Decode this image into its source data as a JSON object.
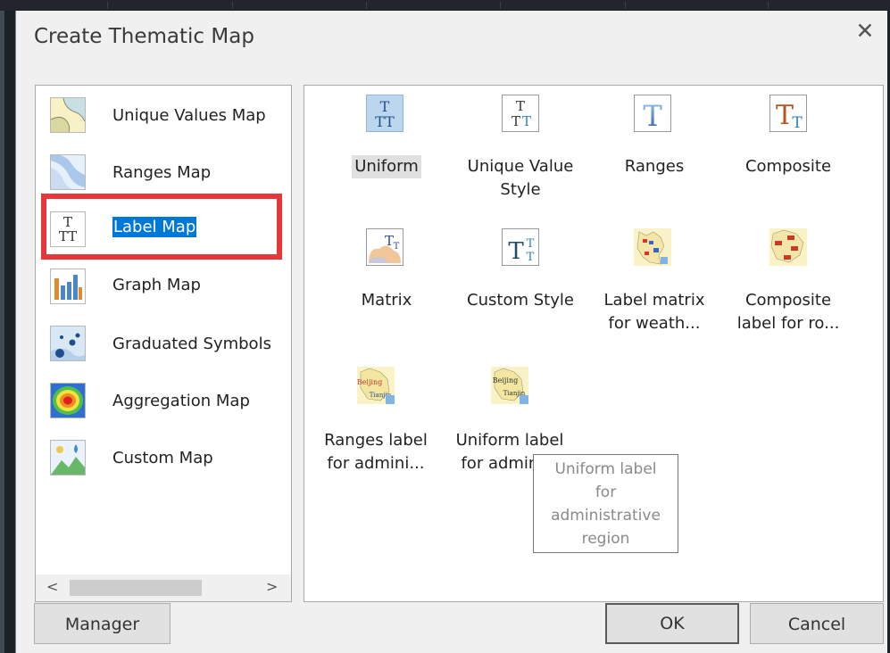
{
  "dialog": {
    "title": "Create Thematic Map",
    "close_symbol": "✕"
  },
  "left_list": {
    "items": [
      {
        "label": "Unique Values Map",
        "icon": "unique-values-map-icon"
      },
      {
        "label": "Ranges Map",
        "icon": "ranges-map-icon"
      },
      {
        "label": "Label Map",
        "icon": "label-map-icon",
        "selected": true
      },
      {
        "label": "Graph Map",
        "icon": "graph-map-icon"
      },
      {
        "label": "Graduated Symbols",
        "icon": "graduated-symbols-icon"
      },
      {
        "label": "Aggregation Map",
        "icon": "aggregation-map-icon"
      },
      {
        "label": "Custom Map",
        "icon": "custom-map-icon"
      }
    ],
    "scroll_left": "<",
    "scroll_right": ">"
  },
  "styles": {
    "items": [
      {
        "label": "Uniform",
        "selected": true
      },
      {
        "label_line1": "Unique Value",
        "label_line2": "Style"
      },
      {
        "label": "Ranges"
      },
      {
        "label": "Composite"
      },
      {
        "label": "Matrix"
      },
      {
        "label": "Custom Style"
      },
      {
        "label_line1": "Label matrix",
        "label_line2": "for weath..."
      },
      {
        "label_line1": "Composite",
        "label_line2": "label for ro..."
      },
      {
        "label_line1": "Ranges label",
        "label_line2": "for admini..."
      },
      {
        "label_line1": "Uniform label",
        "label_line2": "for admini..."
      }
    ]
  },
  "tooltip": {
    "lines": [
      "Uniform label",
      "for",
      "administrative",
      "region"
    ]
  },
  "buttons": {
    "manager": "Manager",
    "ok": "OK",
    "cancel": "Cancel"
  },
  "colors": {
    "selection": "#0078d7",
    "highlight_box": "#e8373a"
  }
}
